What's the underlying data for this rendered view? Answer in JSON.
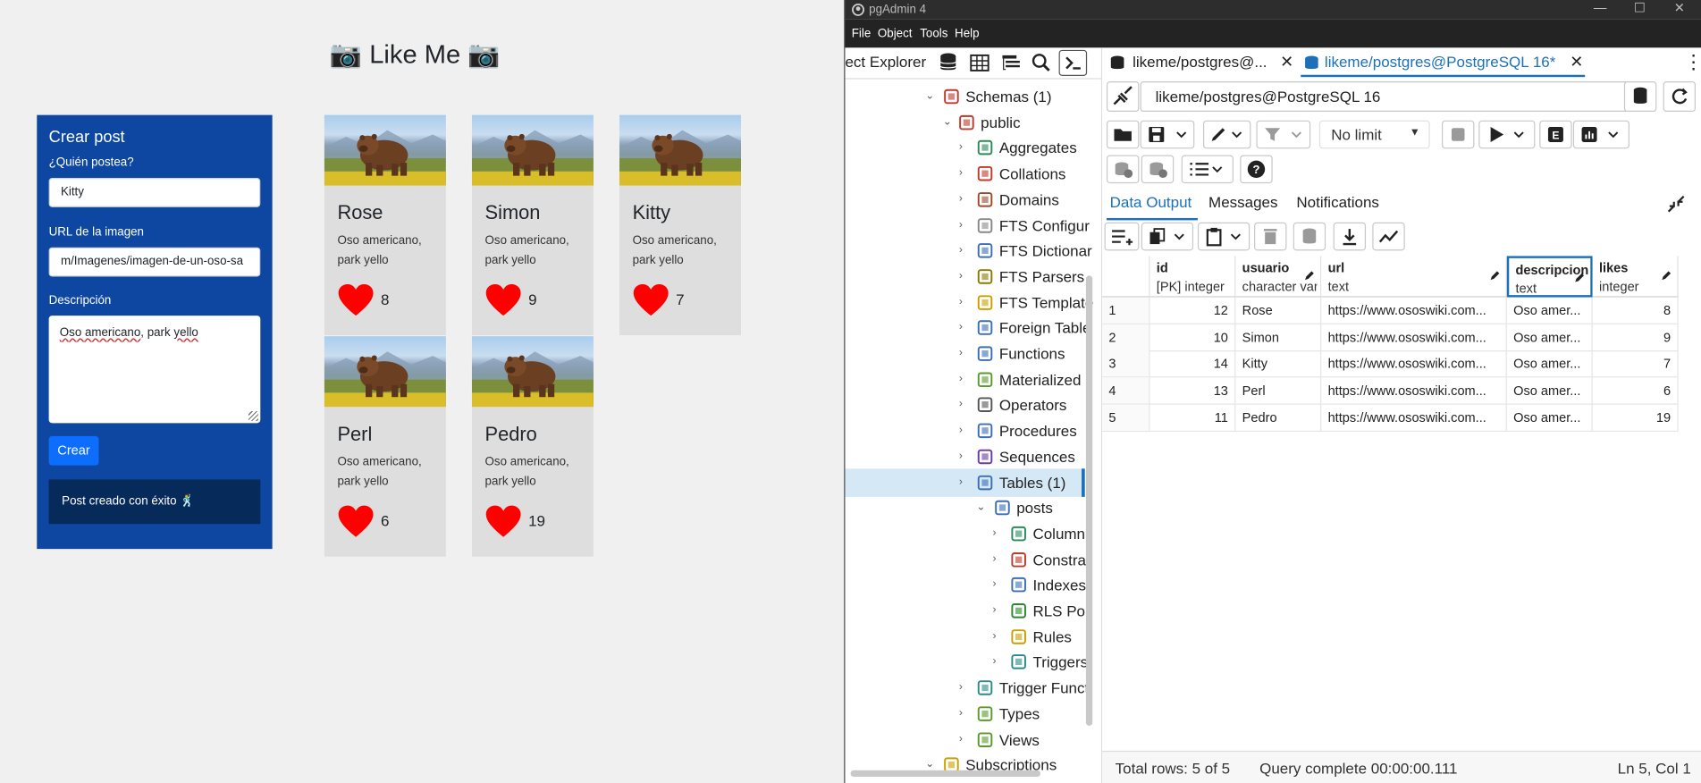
{
  "likeme": {
    "title": "📷 Like Me 📷",
    "form": {
      "heading": "Crear post",
      "user_label": "¿Quién postea?",
      "user_value": "Kitty",
      "url_label": "URL de la imagen",
      "url_value": "m/Imagenes/imagen-de-un-oso-sa",
      "desc_label": "Descripción",
      "desc_value_a": "Oso americano",
      "desc_value_b": ", park ",
      "desc_value_c": "yello",
      "submit_label": "Crear",
      "success_message": "Post creado con éxito 🕺"
    },
    "posts": [
      {
        "name": "Rose",
        "description": "Oso americano, park yello",
        "likes": "8"
      },
      {
        "name": "Simon",
        "description": "Oso americano, park yello",
        "likes": "9"
      },
      {
        "name": "Kitty",
        "description": "Oso americano, park yello",
        "likes": "7"
      },
      {
        "name": "Perl",
        "description": "Oso americano, park yello",
        "likes": "6"
      },
      {
        "name": "Pedro",
        "description": "Oso americano, park yello",
        "likes": "19"
      }
    ],
    "colors": {
      "panel": "#0d47a1",
      "button": "#0d6efd",
      "alert": "#062a5a",
      "heart": "#ff0000"
    }
  },
  "pgadmin": {
    "window_title": "pgAdmin 4",
    "window_controls": [
      "—",
      "☐",
      "✕"
    ],
    "menu": [
      "File",
      "Object",
      "Tools",
      "Help"
    ],
    "explorer_title": "ect Explorer",
    "tree": [
      {
        "label": "Schemas (1)",
        "icon": "schemas-icon"
      },
      {
        "label": "public",
        "icon": "schema-icon"
      },
      {
        "label": "Aggregates",
        "icon": "aggregates-icon"
      },
      {
        "label": "Collations",
        "icon": "collations-icon"
      },
      {
        "label": "Domains",
        "icon": "domains-icon"
      },
      {
        "label": "FTS Configur",
        "icon": "fts-config-icon"
      },
      {
        "label": "FTS Dictionar",
        "icon": "fts-dictionary-icon"
      },
      {
        "label": "FTS Parsers",
        "icon": "fts-parsers-icon"
      },
      {
        "label": "FTS Template",
        "icon": "fts-template-icon"
      },
      {
        "label": "Foreign Table",
        "icon": "foreign-table-icon"
      },
      {
        "label": "Functions",
        "icon": "functions-icon"
      },
      {
        "label": "Materialized",
        "icon": "materialized-view-icon"
      },
      {
        "label": "Operators",
        "icon": "operators-icon"
      },
      {
        "label": "Procedures",
        "icon": "procedures-icon"
      },
      {
        "label": "Sequences",
        "icon": "sequences-icon"
      },
      {
        "label": "Tables (1)",
        "icon": "tables-icon"
      },
      {
        "label": "posts",
        "icon": "table-icon"
      },
      {
        "label": "Column",
        "icon": "columns-icon"
      },
      {
        "label": "Constra",
        "icon": "constraints-icon"
      },
      {
        "label": "Indexes",
        "icon": "indexes-icon"
      },
      {
        "label": "RLS Pol",
        "icon": "rls-policy-icon"
      },
      {
        "label": "Rules",
        "icon": "rules-icon"
      },
      {
        "label": "Triggers",
        "icon": "triggers-icon"
      },
      {
        "label": "Trigger Funct",
        "icon": "trigger-functions-icon"
      },
      {
        "label": "Types",
        "icon": "types-icon"
      },
      {
        "label": "Views",
        "icon": "views-icon"
      },
      {
        "label": "Subscriptions",
        "icon": "subscriptions-icon"
      }
    ],
    "tabs": [
      {
        "label": "likeme/postgres@..."
      },
      {
        "label": "likeme/postgres@PostgreSQL 16*"
      }
    ],
    "more_icon": "⋮",
    "connection": "likeme/postgres@PostgreSQL 16",
    "limit": "No limit",
    "output_tabs": [
      "Data Output",
      "Messages",
      "Notifications"
    ],
    "columns": [
      {
        "name": "",
        "type": ""
      },
      {
        "name": "id",
        "type": "[PK] integer"
      },
      {
        "name": "usuario",
        "type": "character vary"
      },
      {
        "name": "url",
        "type": "text"
      },
      {
        "name": "descripcion",
        "type": "text"
      },
      {
        "name": "likes",
        "type": "integer"
      }
    ],
    "rows": [
      [
        "1",
        "12",
        "Rose",
        "https://www.ososwiki.com...",
        "Oso amer...",
        "8"
      ],
      [
        "2",
        "10",
        "Simon",
        "https://www.ososwiki.com...",
        "Oso amer...",
        "9"
      ],
      [
        "3",
        "14",
        "Kitty",
        "https://www.ososwiki.com...",
        "Oso amer...",
        "7"
      ],
      [
        "4",
        "13",
        "Perl",
        "https://www.ososwiki.com...",
        "Oso amer...",
        "6"
      ],
      [
        "5",
        "11",
        "Pedro",
        "https://www.ososwiki.com...",
        "Oso amer...",
        "19"
      ]
    ],
    "status": {
      "total_rows": "Total rows: 5 of 5",
      "query": "Query complete 00:00:00.111",
      "cursor": "Ln 5, Col 1"
    },
    "colors": {
      "accent": "#1c70b8",
      "titlebar": "#2d2d2d",
      "menubar": "#232323"
    }
  }
}
